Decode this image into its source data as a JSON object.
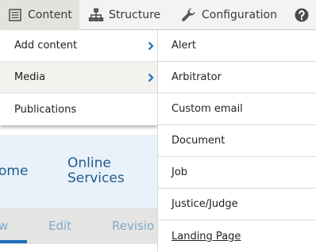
{
  "toolbar": {
    "content_label": "Content",
    "structure_label": "Structure",
    "configuration_label": "Configuration",
    "help_icon": "help-icon"
  },
  "content_menu": {
    "items": [
      {
        "label": "Add content",
        "has_submenu": true
      },
      {
        "label": "Media",
        "has_submenu": true
      },
      {
        "label": "Publications",
        "has_submenu": false
      }
    ]
  },
  "media_submenu": {
    "items": [
      {
        "label": "Alert"
      },
      {
        "label": "Arbitrator"
      },
      {
        "label": "Custom email"
      },
      {
        "label": "Document"
      },
      {
        "label": "Job"
      },
      {
        "label": "Justice/Judge"
      },
      {
        "label": "Landing Page"
      }
    ]
  },
  "page": {
    "home_fragment": "ome",
    "online_services_line1": "Online",
    "online_services_line2": "Services",
    "tabs": [
      {
        "label": "w"
      },
      {
        "label": "Edit"
      },
      {
        "label": "Revisio"
      }
    ]
  },
  "colors": {
    "accent": "#1d6fb8",
    "chevron": "#1d6fb8",
    "toolbar_bg": "#f3f3f1",
    "hero_bg": "#e9f1fa",
    "link": "#1e5c8c"
  }
}
